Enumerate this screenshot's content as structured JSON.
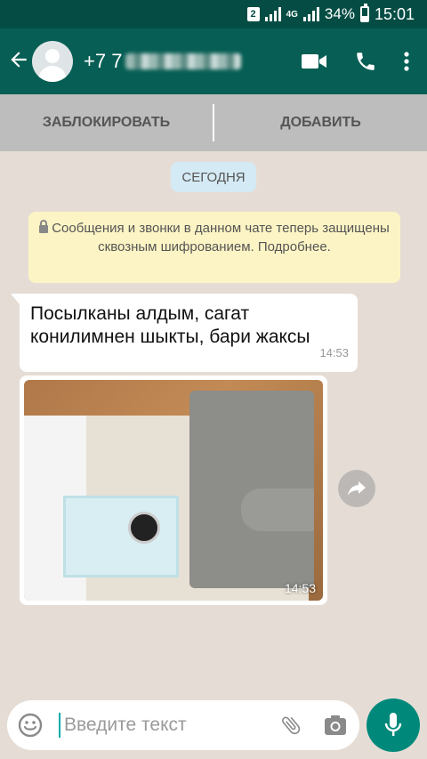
{
  "status_bar": {
    "sim_badge": "2",
    "network_type": "4G",
    "battery": "34%",
    "time": "15:01"
  },
  "header": {
    "back_icon": "arrow-left-icon",
    "contact_name_visible": "+7 7",
    "actions": [
      "video-call-icon",
      "phone-icon",
      "more-vertical-icon"
    ]
  },
  "action_bar": {
    "block_label": "ЗАБЛОКИРОВАТЬ",
    "add_label": "ДОБАВИТЬ"
  },
  "chat": {
    "date_label": "СЕГОДНЯ",
    "encryption_notice": "Сообщения и звонки в данном чате теперь защищены сквозным шифрованием. Подробнее.",
    "messages": [
      {
        "type": "text",
        "text": "Посылканы алдым, сагат конилимнен шыкты, бари жаксы",
        "time": "14:53"
      },
      {
        "type": "image",
        "time": "14:53"
      }
    ]
  },
  "input": {
    "placeholder": "Введите текст"
  },
  "colors": {
    "status_bar": "#054d44",
    "app_bar": "#075e54",
    "action_bar": "#bdbdbd",
    "chat_bg": "#e5ddd5",
    "date_chip": "#d4eaf4",
    "notice_bg": "#fdf4c5",
    "mic_button": "#00897b"
  }
}
